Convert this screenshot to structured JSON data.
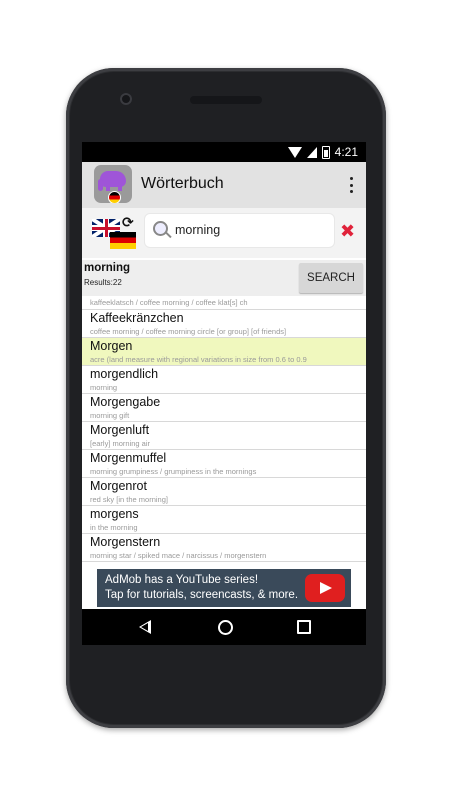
{
  "status": {
    "time": "4:21"
  },
  "appbar": {
    "title": "Wörterbuch"
  },
  "search": {
    "query": "morning"
  },
  "results": {
    "word": "morning",
    "count": "Results:22",
    "search_button": "SEARCH"
  },
  "entries": [
    {
      "word": "",
      "translation": "kaffeeklatsch / coffee morning / coffee klat[s] ch",
      "partial": true
    },
    {
      "word": "Kaffeekränzchen",
      "translation": "coffee morning / coffee morning circle [or group] [of friends]"
    },
    {
      "word": "Morgen",
      "translation": "acre (land measure with regional variations in size from 0.6 to 0.9",
      "highlighted": true
    },
    {
      "word": "morgendlich",
      "translation": "morning"
    },
    {
      "word": "Morgengabe",
      "translation": "morning gift"
    },
    {
      "word": "Morgenluft",
      "translation": "[early] morning air"
    },
    {
      "word": "Morgenmuffel",
      "translation": "morning grumpiness / grumpiness in the mornings"
    },
    {
      "word": "Morgenrot",
      "translation": "red sky [in the morning]"
    },
    {
      "word": "morgens",
      "translation": "in the morning"
    },
    {
      "word": "Morgenstern",
      "translation": "morning star / spiked mace / narcissus / morgenstern"
    }
  ],
  "ad": {
    "line1": "AdMob has a YouTube series!",
    "line2": "Tap for tutorials, screencasts, & more."
  },
  "colors": {
    "highlight": "#f0f8be",
    "clear_accent": "#e0223a",
    "app_icon_elephant": "#9f55d8"
  },
  "icons": [
    "wifi-icon",
    "signal-icon",
    "battery-icon",
    "overflow-menu-icon",
    "search-icon",
    "clear-icon",
    "swap-languages-icon",
    "youtube-play-icon",
    "back-icon",
    "home-icon",
    "recents-icon"
  ]
}
